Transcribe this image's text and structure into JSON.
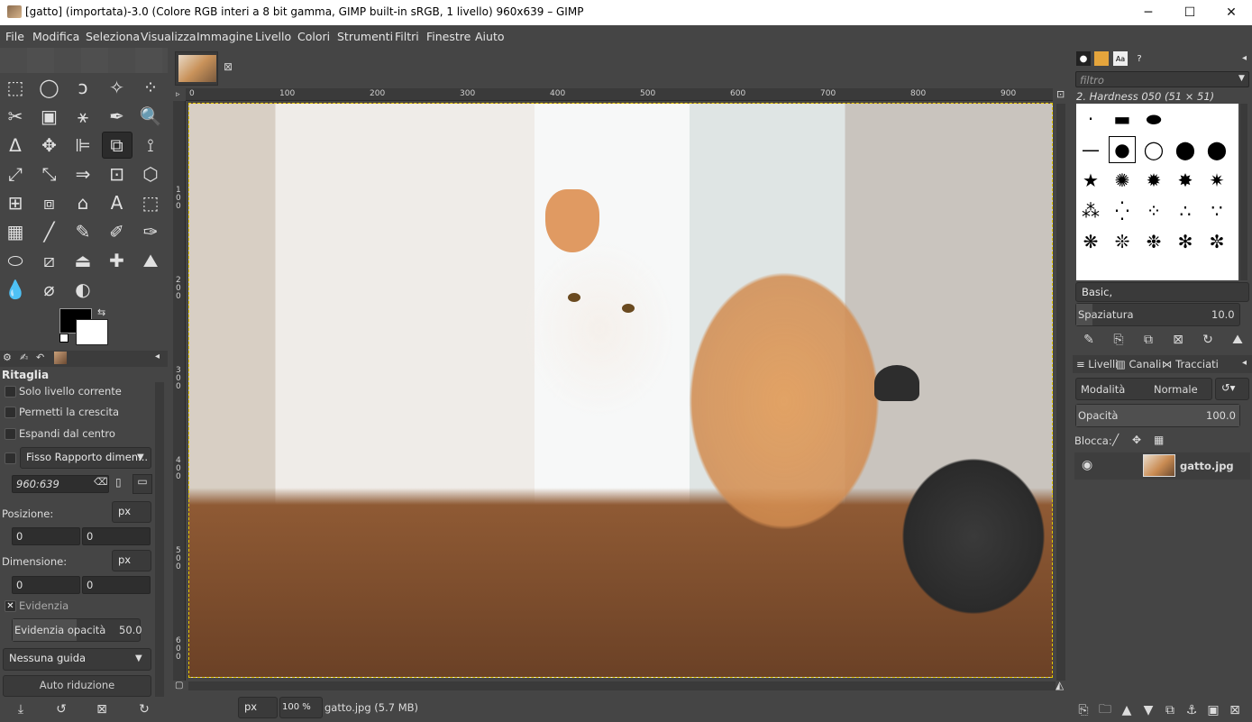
{
  "window": {
    "title": "[gatto] (importata)-3.0 (Colore RGB interi a 8 bit gamma, GIMP built-in sRGB, 1 livello) 960x639 – GIMP",
    "minimize": "─",
    "maximize": "☐",
    "close": "✕"
  },
  "menu": [
    "File",
    "Modifica",
    "Seleziona",
    "Visualizza",
    "Immagine",
    "Livello",
    "Colori",
    "Strumenti",
    "Filtri",
    "Finestre",
    "Aiuto"
  ],
  "tools": [
    [
      "⬚",
      "◯",
      "ↄ",
      "✧",
      "⁘"
    ],
    [
      "✂",
      "▣",
      "⚹",
      "✒",
      "🔍"
    ],
    [
      "ᐃ",
      "✥",
      "⊫",
      "⧉",
      "⟟"
    ],
    [
      "⤢",
      "⤡",
      "⇒",
      "⊡",
      "⬡"
    ],
    [
      "⊞",
      "⧈",
      "⌂",
      "A",
      "⬚"
    ],
    [
      "▦",
      "╱",
      "✎",
      "✐",
      "✑"
    ],
    [
      "⬭",
      "⧄",
      "⏏",
      "✚",
      "⛰"
    ],
    [
      "💧",
      "⌀",
      "◐"
    ]
  ],
  "tool_options": {
    "title": "Ritaglia",
    "only_current_layer": "Solo livello corrente",
    "allow_growing": "Permetti la crescita",
    "expand_center": "Espandi dal centro",
    "fixed_combo": "Fisso Rapporto dimen...",
    "ratio_value": "960:639",
    "position_label": "Posizione:",
    "position_unit": "px",
    "pos_x": "0",
    "pos_y": "0",
    "size_label": "Dimensione:",
    "size_unit": "px",
    "size_w": "0",
    "size_h": "0",
    "highlight": "Evidenzia",
    "highlight_opacity_label": "Evidenzia opacità",
    "highlight_opacity_value": "50.0",
    "highlight_opacity_level": 0.5,
    "guides": "Nessuna guida",
    "auto_shrink": "Auto riduzione"
  },
  "canvas": {
    "ruler_labels": [
      "0",
      "100",
      "200",
      "300",
      "400",
      "500",
      "600",
      "700",
      "800",
      "900"
    ],
    "vruler_labels": [
      "1\n0\n0",
      "2\n0\n0",
      "3\n0\n0",
      "4\n0\n0",
      "5\n0\n0",
      "6\n0\n0"
    ],
    "status_unit": "px",
    "zoom": "100 %",
    "status_text": "gatto.jpg (5.7 MB)"
  },
  "brushes": {
    "filter_placeholder": "filtro",
    "selected": "2. Hardness 050 (51 × 51)",
    "tag": "Basic,",
    "spacing_label": "Spaziatura",
    "spacing_value": "10.0",
    "spacing_level": 0.1
  },
  "layers": {
    "tab_layers": "Livelli",
    "tab_channels": "Canali",
    "tab_paths": "Tracciati",
    "mode_label": "Modalità",
    "mode_value": "Normale",
    "opacity_label": "Opacità",
    "opacity_value": "100.0",
    "opacity_level": 1.0,
    "lock_label": "Blocca:",
    "layer_name": "gatto.jpg"
  }
}
